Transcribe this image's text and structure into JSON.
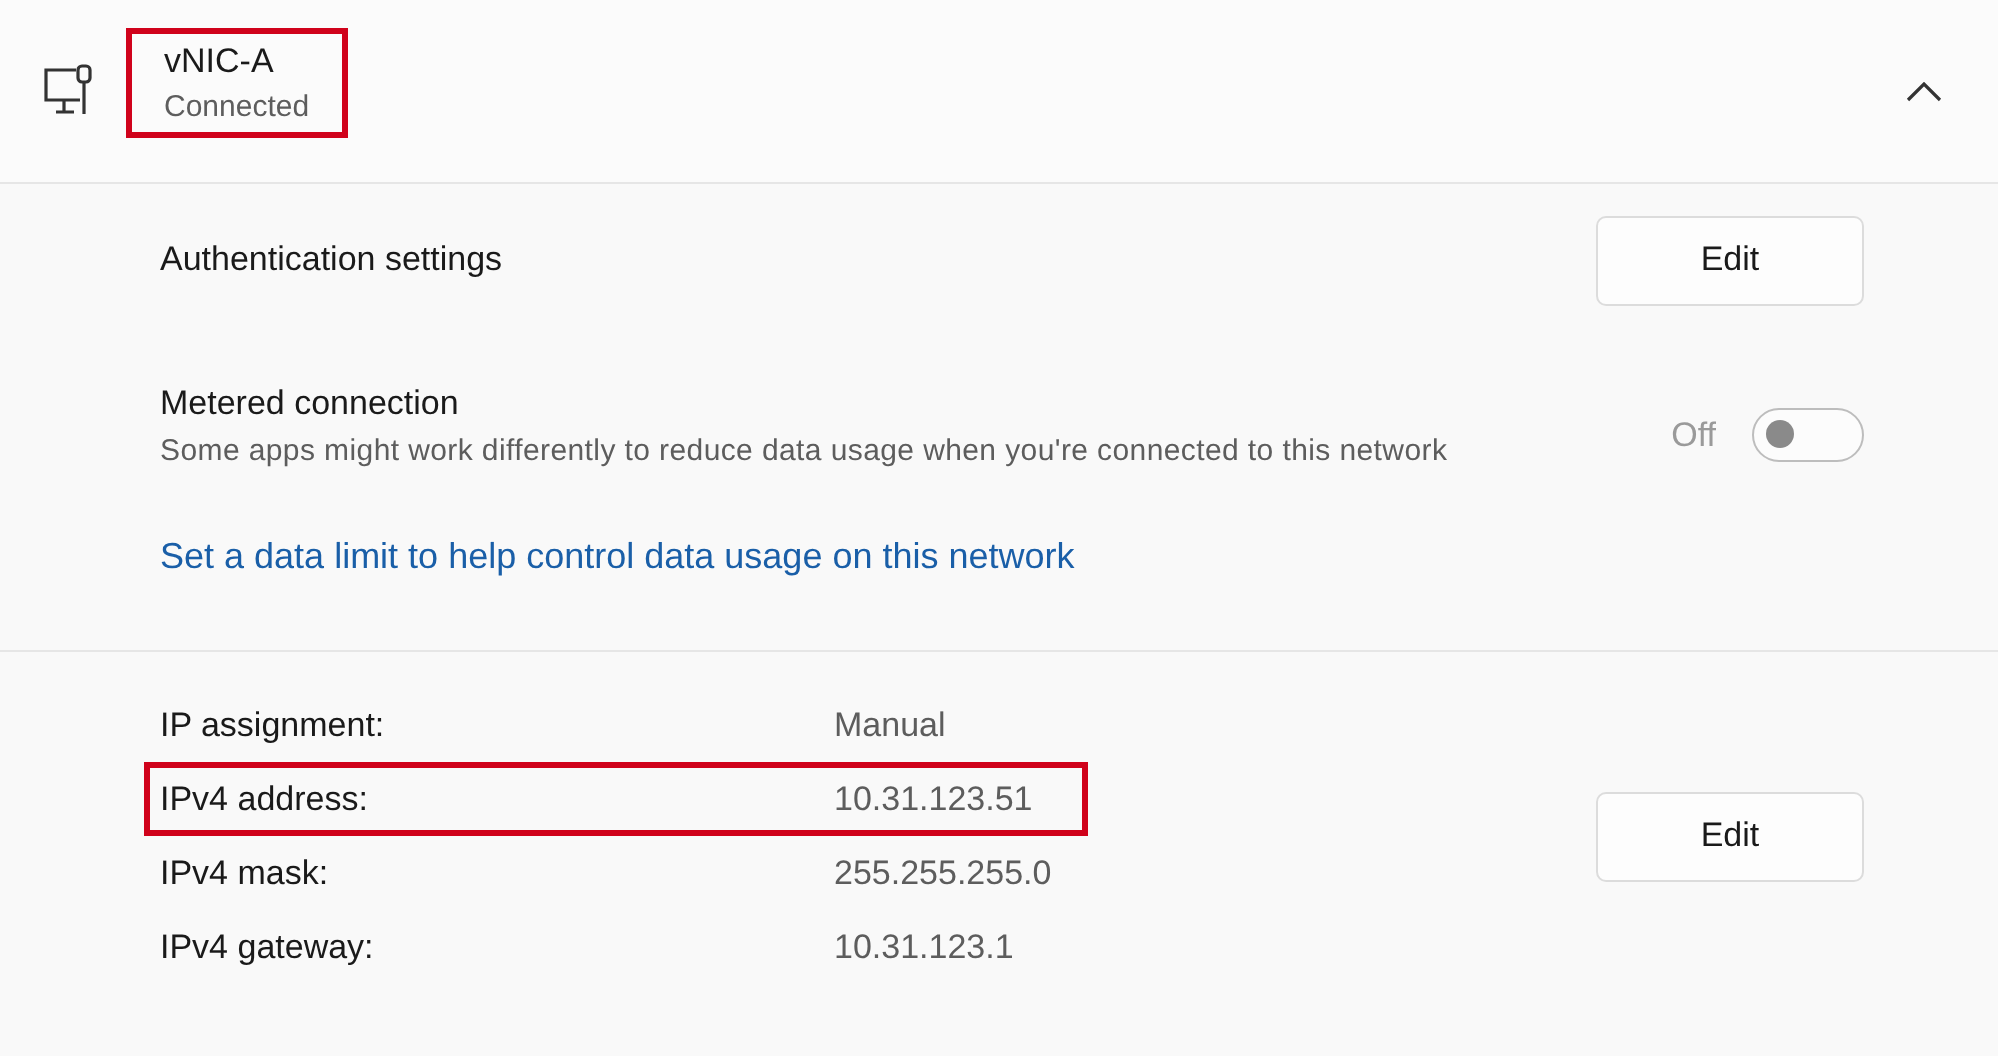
{
  "adapter": {
    "name": "vNIC-A",
    "status": "Connected",
    "highlighted": true,
    "expanded": true
  },
  "authentication": {
    "label": "Authentication settings",
    "button": "Edit"
  },
  "metered": {
    "title": "Metered connection",
    "description": "Some apps might work differently to reduce data usage when you're connected to this network",
    "state_label": "Off",
    "on": false
  },
  "data_limit_link": "Set a data limit to help control data usage on this network",
  "ip_settings": {
    "rows": [
      {
        "label": "IP assignment:",
        "value": "Manual",
        "highlighted": false
      },
      {
        "label": "IPv4 address:",
        "value": "10.31.123.51",
        "highlighted": true
      },
      {
        "label": "IPv4 mask:",
        "value": "255.255.255.0",
        "highlighted": false
      },
      {
        "label": "IPv4 gateway:",
        "value": "10.31.123.1",
        "highlighted": false
      }
    ],
    "button": "Edit"
  }
}
